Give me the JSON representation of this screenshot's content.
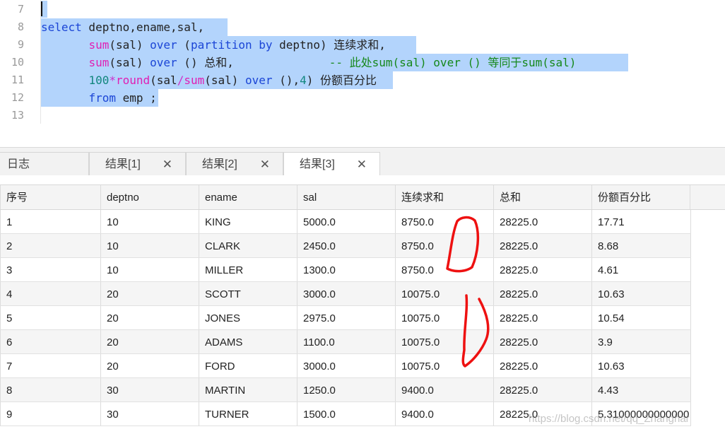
{
  "editor": {
    "line_numbers": [
      "7",
      "8",
      "9",
      "10",
      "11",
      "12",
      "13"
    ],
    "lines": [
      {
        "parts": []
      },
      {
        "parts": [
          {
            "t": "select",
            "c": "kw"
          },
          {
            "t": " deptno,ename,sal,",
            "c": ""
          }
        ]
      },
      {
        "parts": [
          {
            "t": "       ",
            "c": ""
          },
          {
            "t": "sum",
            "c": "fn"
          },
          {
            "t": "(sal) ",
            "c": ""
          },
          {
            "t": "over",
            "c": "kw"
          },
          {
            "t": " (",
            "c": ""
          },
          {
            "t": "partition by",
            "c": "kw"
          },
          {
            "t": " deptno) 连续求和,",
            "c": ""
          }
        ]
      },
      {
        "parts": [
          {
            "t": "       ",
            "c": ""
          },
          {
            "t": "sum",
            "c": "fn"
          },
          {
            "t": "(sal) ",
            "c": ""
          },
          {
            "t": "over",
            "c": "kw"
          },
          {
            "t": " () 总和,",
            "c": ""
          },
          {
            "t": "              -- 此处sum(sal) over () 等同于sum(sal)",
            "c": "cm"
          }
        ]
      },
      {
        "parts": [
          {
            "t": "       ",
            "c": ""
          },
          {
            "t": "100",
            "c": "num"
          },
          {
            "t": "*",
            "c": "op"
          },
          {
            "t": "round",
            "c": "fn"
          },
          {
            "t": "(sal",
            "c": ""
          },
          {
            "t": "/",
            "c": "op"
          },
          {
            "t": "sum",
            "c": "fn"
          },
          {
            "t": "(sal) ",
            "c": ""
          },
          {
            "t": "over",
            "c": "kw"
          },
          {
            "t": " (),",
            "c": ""
          },
          {
            "t": "4",
            "c": "num"
          },
          {
            "t": ") 份额百分比",
            "c": ""
          }
        ]
      },
      {
        "parts": [
          {
            "t": "       ",
            "c": ""
          },
          {
            "t": "from",
            "c": "kw"
          },
          {
            "t": " emp ;",
            "c": ""
          }
        ]
      },
      {
        "parts": []
      }
    ]
  },
  "tabs": {
    "log": "日志",
    "results": [
      "结果[1]",
      "结果[2]",
      "结果[3]"
    ],
    "close_glyph": "✕",
    "active_index": 2
  },
  "grid": {
    "columns": [
      "序号",
      "deptno",
      "ename",
      "sal",
      "连续求和",
      "总和",
      "份额百分比"
    ],
    "rows": [
      [
        "1",
        "10",
        "KING",
        "5000.0",
        "8750.0",
        "28225.0",
        "17.71"
      ],
      [
        "2",
        "10",
        "CLARK",
        "2450.0",
        "8750.0",
        "28225.0",
        "8.68"
      ],
      [
        "3",
        "10",
        "MILLER",
        "1300.0",
        "8750.0",
        "28225.0",
        "4.61"
      ],
      [
        "4",
        "20",
        "SCOTT",
        "3000.0",
        "10075.0",
        "28225.0",
        "10.63"
      ],
      [
        "5",
        "20",
        "JONES",
        "2975.0",
        "10075.0",
        "28225.0",
        "10.54"
      ],
      [
        "6",
        "20",
        "ADAMS",
        "1100.0",
        "10075.0",
        "28225.0",
        "3.9"
      ],
      [
        "7",
        "20",
        "FORD",
        "3000.0",
        "10075.0",
        "28225.0",
        "10.63"
      ],
      [
        "8",
        "30",
        "MARTIN",
        "1250.0",
        "9400.0",
        "28225.0",
        "4.43"
      ],
      [
        "9",
        "30",
        "TURNER",
        "1500.0",
        "9400.0",
        "28225.0",
        "5.31000000000000"
      ]
    ]
  },
  "watermark": "https://blog.csdn.net/qq_Zhanghar",
  "colors": {
    "selection": "#b3d4fc",
    "keyword": "#1b45d6",
    "function": "#e01fb4",
    "number": "#11867d",
    "comment": "#15881a",
    "annotation": "#ee1111"
  }
}
